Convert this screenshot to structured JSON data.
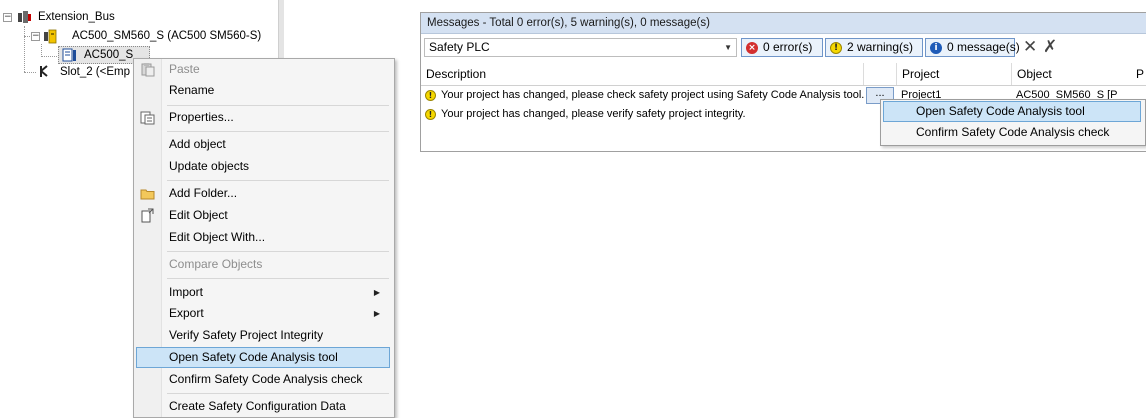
{
  "tree": {
    "items": [
      {
        "label": "Extension_Bus",
        "icon": "extension-bus-icon"
      },
      {
        "label": "AC500_SM560_S (AC500 SM560-S)",
        "icon": "safety-module-icon"
      },
      {
        "label": "AC500_S",
        "icon": "safety-application-icon"
      },
      {
        "label": "Slot_2 (<Emp",
        "icon": "slot-icon"
      }
    ]
  },
  "context_menu": {
    "items": [
      {
        "label": "Paste",
        "enabled": false,
        "icon": "paste-icon"
      },
      {
        "label": "Rename",
        "enabled": true
      },
      {
        "label": "Properties...",
        "enabled": true,
        "icon": "properties-icon"
      },
      {
        "label": "Add object",
        "enabled": true
      },
      {
        "label": "Update objects",
        "enabled": true
      },
      {
        "label": "Add Folder...",
        "enabled": true,
        "icon": "folder-icon"
      },
      {
        "label": "Edit Object",
        "enabled": true,
        "icon": "edit-object-icon"
      },
      {
        "label": "Edit Object With...",
        "enabled": true
      },
      {
        "label": "Compare Objects",
        "enabled": false
      },
      {
        "label": "Import",
        "enabled": true,
        "submenu": true
      },
      {
        "label": "Export",
        "enabled": true,
        "submenu": true
      },
      {
        "label": "Verify Safety Project Integrity",
        "enabled": true
      },
      {
        "label": "Open Safety Code Analysis tool",
        "enabled": true,
        "highlighted": true
      },
      {
        "label": "Confirm Safety Code Analysis check",
        "enabled": true
      },
      {
        "label": "Create Safety Configuration Data",
        "enabled": true
      }
    ]
  },
  "messages": {
    "title": "Messages - Total 0 error(s), 5 warning(s), 0 message(s)",
    "filter_value": "Safety PLC",
    "errors_btn": "0 error(s)",
    "warnings_btn": "2 warning(s)",
    "messages_btn": "0 message(s)",
    "columns": {
      "description": "Description",
      "project": "Project",
      "object": "Object",
      "extra": "P"
    },
    "rows": [
      {
        "description": "Your project has changed, please check safety project using Safety Code Analysis tool.",
        "action": "...",
        "project": "Project1",
        "object": "AC500_SM560_S [P"
      },
      {
        "description": "Your project has changed, please verify safety project integrity.",
        "project": "",
        "object": ""
      }
    ],
    "popup": {
      "items": [
        {
          "label": "Open Safety Code Analysis tool",
          "highlighted": true
        },
        {
          "label": "Confirm Safety Code Analysis check"
        }
      ]
    }
  },
  "colors": {
    "highlight_bg": "#cce4f7",
    "highlight_border": "#6da6d6",
    "title_bar": "#d4e1f2",
    "warning": "#f6d800",
    "error": "#d32f2f",
    "info": "#1e5bb8"
  }
}
